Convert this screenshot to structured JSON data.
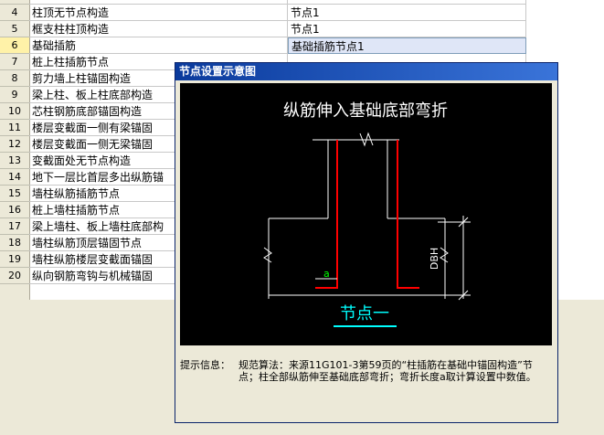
{
  "table": {
    "rows": [
      {
        "num": "",
        "name": "",
        "value": "",
        "partial": true
      },
      {
        "num": "4",
        "name": "柱顶无节点构造",
        "value": "节点1"
      },
      {
        "num": "5",
        "name": "框支柱柱顶构造",
        "value": "节点1"
      },
      {
        "num": "6",
        "name": "基础插筋",
        "value": "基础插筋节点1",
        "selected": true
      },
      {
        "num": "7",
        "name": "桩上柱插筋节点",
        "value": ""
      },
      {
        "num": "8",
        "name": "剪力墙上柱锚固构造",
        "value": ""
      },
      {
        "num": "9",
        "name": "梁上柱、板上柱底部构造",
        "value": ""
      },
      {
        "num": "10",
        "name": "芯柱钢筋底部锚固构造",
        "value": ""
      },
      {
        "num": "11",
        "name": "楼层变截面一侧有梁锚固",
        "value": ""
      },
      {
        "num": "12",
        "name": "楼层变截面一侧无梁锚固",
        "value": ""
      },
      {
        "num": "13",
        "name": "变截面处无节点构造",
        "value": ""
      },
      {
        "num": "14",
        "name": "地下一层比首层多出纵筋锚",
        "value": ""
      },
      {
        "num": "15",
        "name": "墙柱纵筋插筋节点",
        "value": ""
      },
      {
        "num": "16",
        "name": "桩上墙柱插筋节点",
        "value": ""
      },
      {
        "num": "17",
        "name": "梁上墙柱、板上墙柱底部构",
        "value": ""
      },
      {
        "num": "18",
        "name": "墙柱纵筋顶层锚固节点",
        "value": ""
      },
      {
        "num": "19",
        "name": "墙柱纵筋楼层变截面锚固",
        "value": ""
      },
      {
        "num": "20",
        "name": "纵向钢筋弯钩与机械锚固",
        "value": ""
      }
    ]
  },
  "dialog": {
    "title": "节点设置示意图",
    "diagram": {
      "heading": "纵筋伸入基础底部弯折",
      "dim_label": "DBH",
      "hook_label": "a",
      "caption": "节点一"
    },
    "info_label": "提示信息：",
    "info_text": "规范算法：来源11G101-3第59页的“柱插筋在基础中锚固构造”节点；柱全部纵筋伸至基础底部弯折；弯折长度a取计算设置中数值。"
  },
  "colors": {
    "rebar": "#ff0000",
    "outline": "#ffffff",
    "dim_text": "#00ff00",
    "caption": "#00ffff",
    "selected_bg": "#dfe6f7",
    "titlebar": "#0a3a9c"
  }
}
